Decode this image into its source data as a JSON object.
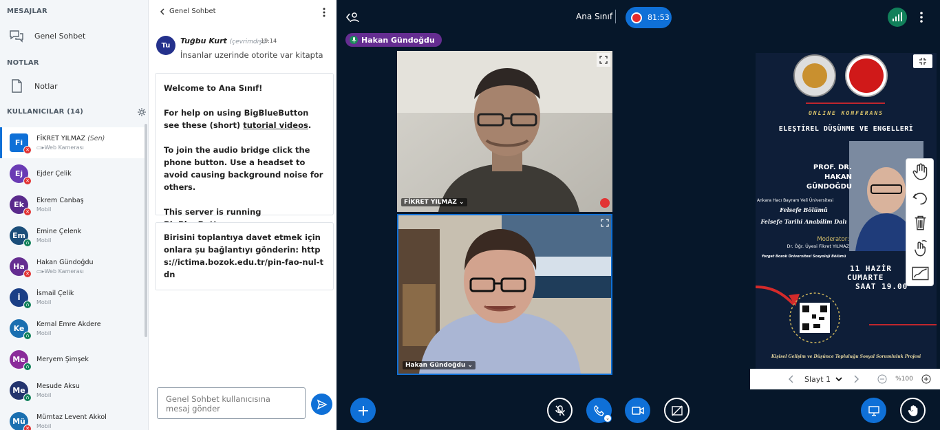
{
  "sidebar": {
    "messages_title": "MESAJLAR",
    "public_chat_label": "Genel Sohbet",
    "notes_title": "NOTLAR",
    "notes_label": "Notlar",
    "users_title": "KULLANICILAR (14)",
    "users": [
      {
        "initials": "Fi",
        "name": "FİKRET YILMAZ",
        "you": "(Sen)",
        "status": "Web Kamerası",
        "color": "#0f70d7",
        "square": true,
        "badge": "muted",
        "self": true
      },
      {
        "initials": "Ej",
        "name": "Ejder Çelik",
        "status": "",
        "color": "#6a3bb4",
        "badge": "muted"
      },
      {
        "initials": "Ek",
        "name": "Ekrem Canbaş",
        "status": "Mobil",
        "color": "#5a2a8c",
        "badge": "muted"
      },
      {
        "initials": "Em",
        "name": "Emine Çelenk",
        "status": "Mobil",
        "color": "#1b4e7a",
        "badge": "listen"
      },
      {
        "initials": "Ha",
        "name": "Hakan Gündoğdu",
        "status": "Web Kamerası",
        "color": "#652d91",
        "badge": "muted"
      },
      {
        "initials": "İ",
        "name": "İsmail Çelik",
        "status": "Mobil",
        "color": "#1b3f86",
        "badge": "listen"
      },
      {
        "initials": "Ke",
        "name": "Kemal Emre Akdere",
        "status": "Mobil",
        "color": "#1a6fb0",
        "badge": "listen"
      },
      {
        "initials": "Me",
        "name": "Meryem Şimşek",
        "status": "",
        "color": "#8a2b9a",
        "badge": "listen"
      },
      {
        "initials": "Me",
        "name": "Mesude Aksu",
        "status": "Mobil",
        "color": "#23346e",
        "badge": "listen"
      },
      {
        "initials": "Mü",
        "name": "Mümtaz Levent Akkol",
        "status": "Mobil",
        "color": "#1a6fb0",
        "badge": "muted"
      }
    ]
  },
  "chat": {
    "header": "Genel Sohbet",
    "message": {
      "initials": "Tu",
      "name": "Tuğbu Kurt",
      "offline": "(çevrimdışı)",
      "time": "19:14",
      "text": "İnsanlar uzerinde otorite var kitapta"
    },
    "welcome": {
      "line1_pre": "Welcome to ",
      "line1_room": "Ana Sınıf",
      "line1_post": "!",
      "line2_pre": "For help on using BigBlueButton see these (short) ",
      "line2_link": "tutorial videos",
      "line2_post": ".",
      "line3": "To join the audio bridge click the phone button. Use a headset to avoid causing background noise for others.",
      "line4_pre": "This server is running ",
      "line4_link": "BigBlueButton",
      "line4_post": "."
    },
    "invite": "Birisini toplantıya davet etmek için onlara şu bağlantıyı gönderin: https://ictima.bozok.edu.tr/pin-fao-nul-tdn",
    "input_placeholder": "Genel Sohbet kullanıcısına mesaj gönder"
  },
  "main": {
    "room_title": "Ana Sınıf",
    "rec_time": "81:53",
    "talking": "Hakan Gündoğdu",
    "video1_label": "FİKRET YILMAZ",
    "video2_label": "Hakan Gündoğdu",
    "slide_label": "Slayt 1",
    "zoom": "%100"
  },
  "presentation": {
    "t_online": "ONLINE KONFERANS",
    "t_title": "ELEŞTİREL DÜŞÜNME VE ENGELLERİ",
    "t_prof": "PROF. DR.",
    "t_name1": "HAKAN",
    "t_name2": "GÜNDOĞDU",
    "t_univ": "Ankara Hacı Bayram Veli Üniversitesi",
    "t_dept1": "Felsefe Bölümü",
    "t_dept2": "Felsefe Tarihi Anabilim Dalı",
    "t_mod": "Moderator:",
    "t_modname": "Dr. Öğr. Üyesi Fikret YILMAZ",
    "t_org": "Yozgat Bozok Üniversitesi Sosyoloji Bölümü",
    "t_date1": "11 HAZİR",
    "t_date2": "CUMARTE",
    "t_date3": "SAAT 19.00",
    "t_bottom": "Kişisel Gelişim ve Düşünce Topluluğu Sosyal Sorumluluk Projesi"
  },
  "colors": {
    "accent": "#0f70d7",
    "talking": "#652d91",
    "rec": "#e62b2b",
    "muted": "#e23434",
    "listen": "#11805a"
  }
}
